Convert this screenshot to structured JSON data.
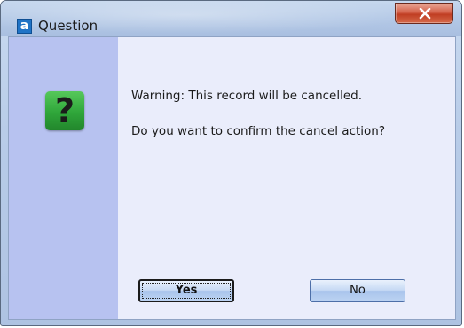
{
  "window": {
    "title": "Question",
    "app_icon_letter": "a",
    "close_icon": "close-x-icon"
  },
  "dialog": {
    "icon": "question-mark-icon",
    "icon_glyph": "?",
    "icon_color": "#3bb443",
    "message_line1": "Warning: This record will be cancelled.",
    "message_line2": "Do you want to confirm the cancel action?"
  },
  "buttons": {
    "yes_label": "Yes",
    "no_label": "No",
    "default": "Yes"
  },
  "colors": {
    "side_strip": "#b7c2f0",
    "client_background": "#eaedfb",
    "close_button": "#d4614a"
  }
}
